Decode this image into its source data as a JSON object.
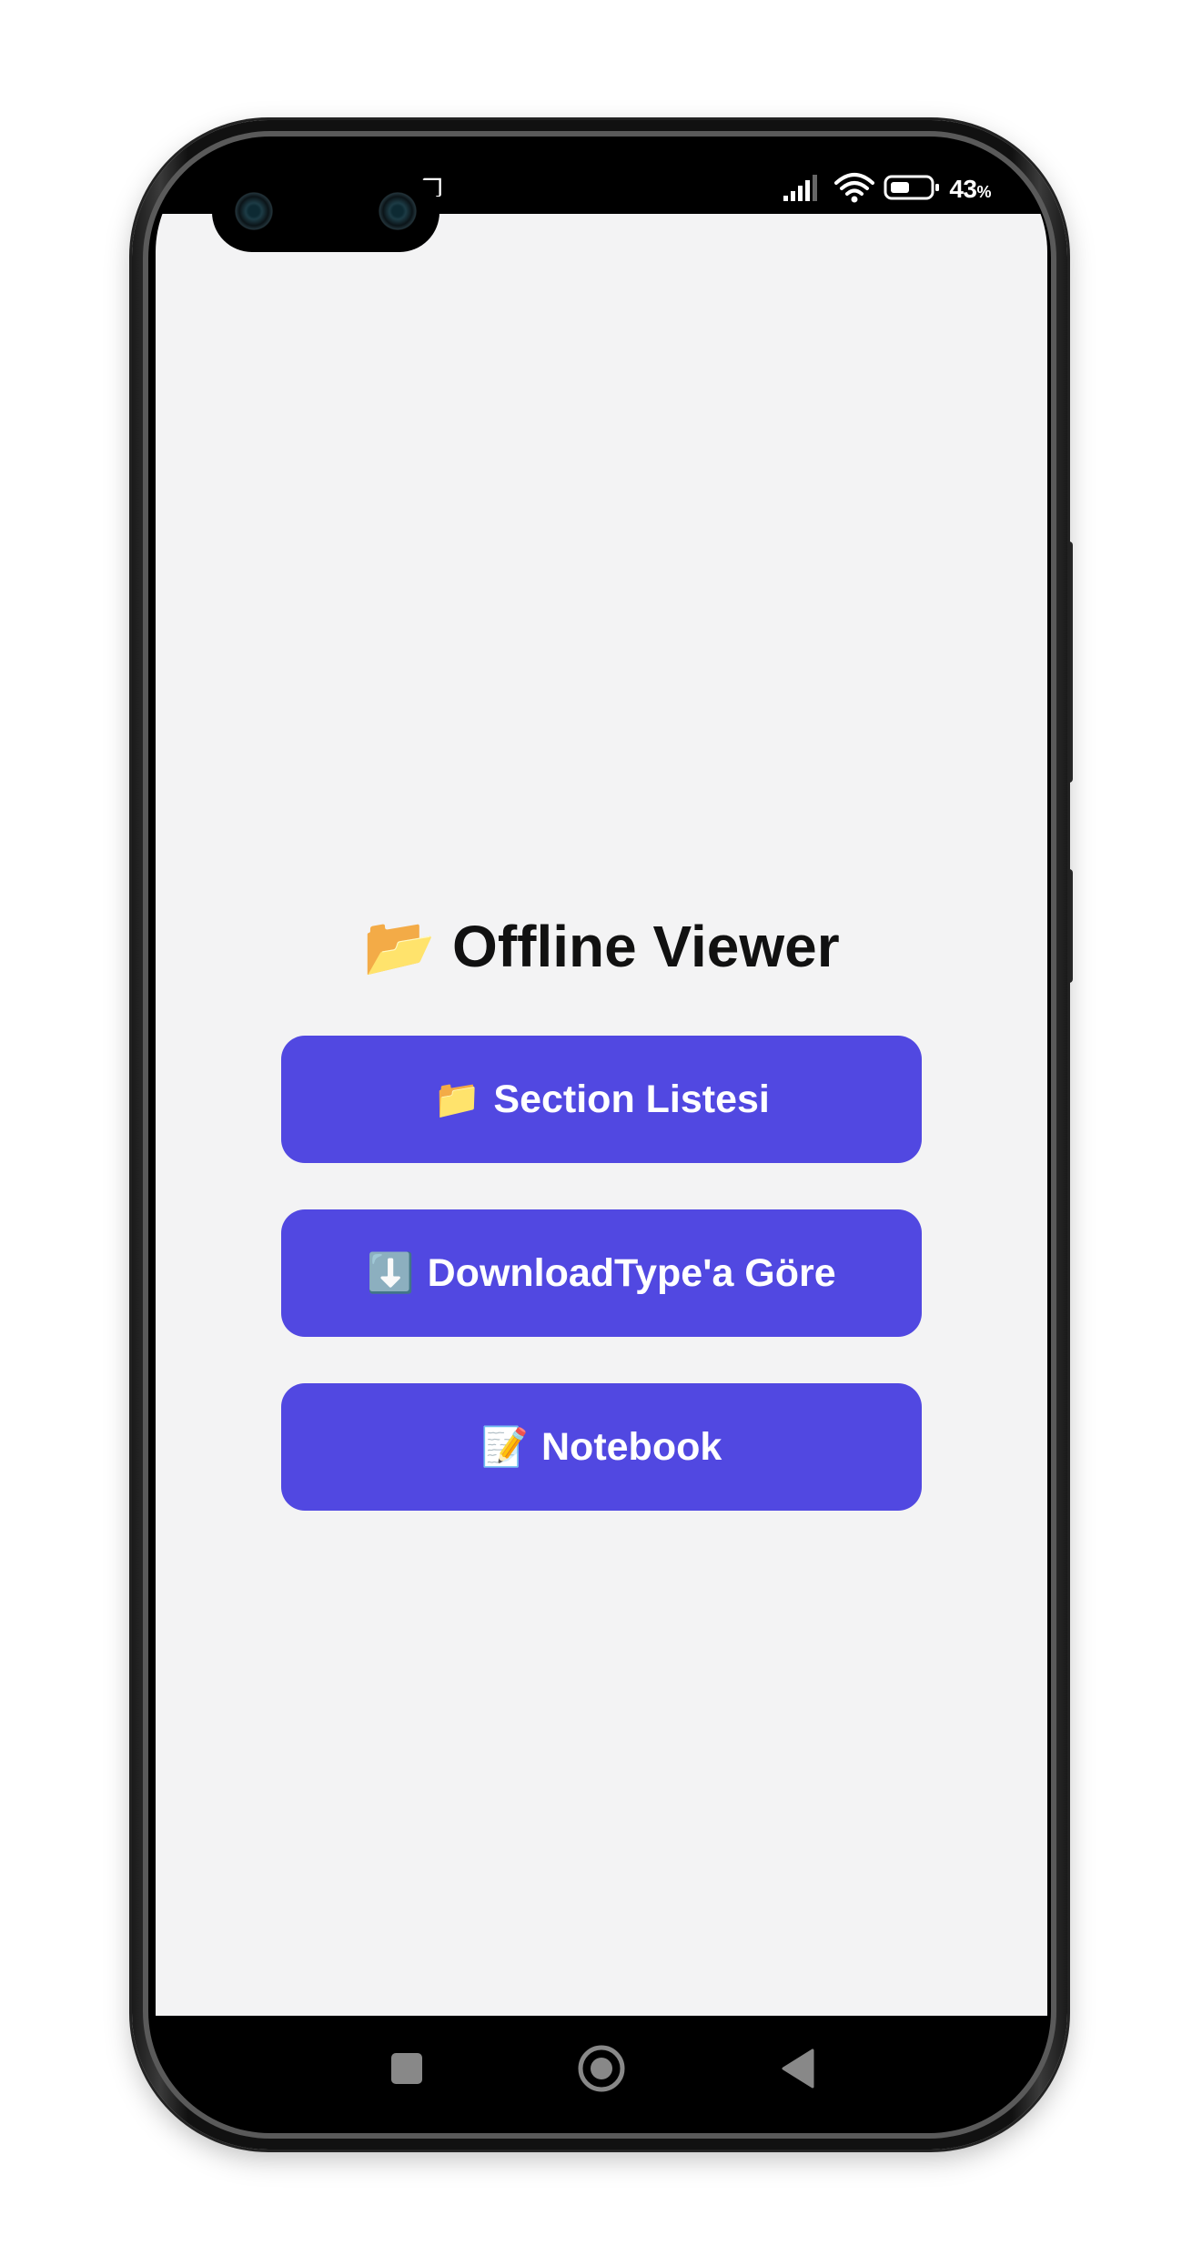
{
  "status_bar": {
    "left_glyph": "❒",
    "battery_percent": "43",
    "battery_unit": "%",
    "icons": [
      "signal-icon",
      "wifi-icon",
      "battery-icon"
    ]
  },
  "app": {
    "title_emoji": "📂",
    "title": "Offline Viewer",
    "background_color": "#f3f3f4",
    "accent_color": "#5148e1",
    "buttons": [
      {
        "emoji": "📁",
        "label": "Section Listesi"
      },
      {
        "emoji": "⬇️",
        "label": "DownloadType'a Göre"
      },
      {
        "emoji": "📝",
        "label": "Notebook"
      }
    ]
  },
  "nav_bar": {
    "items": [
      "recents-square-icon",
      "home-circle-icon",
      "back-triangle-icon"
    ]
  }
}
